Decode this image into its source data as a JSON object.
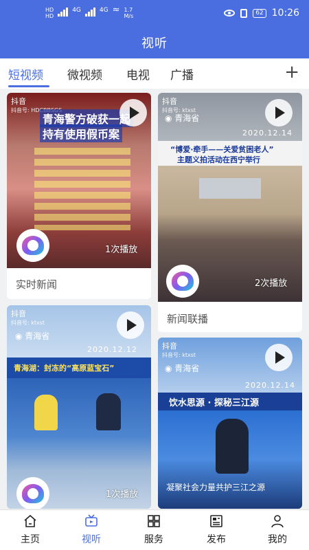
{
  "status": {
    "net1": "HD",
    "net2": "HD",
    "sig1": "4G",
    "sig2": "4G",
    "speed": "1.7",
    "speed_unit": "M/s",
    "battery": "62",
    "time": "10:26"
  },
  "header": {
    "title": "视听"
  },
  "tabs": [
    {
      "label": "短视频",
      "active": true
    },
    {
      "label": "微视频"
    },
    {
      "label": "电视"
    },
    {
      "label": "广播"
    }
  ],
  "cards": [
    {
      "platform": "抖音",
      "account": "抖音号: HDCBBSGS",
      "headline1": "青海警方破获一起",
      "headline2": "持有使用假币案",
      "plays": "1次播放",
      "caption": "实时新闻"
    },
    {
      "platform": "抖音",
      "account": "抖音号: ktxst",
      "location": "青海省",
      "date": "2020.12.14",
      "banner": "“博爱·牵手——关爱贫困老人”",
      "banner2": "主题义拍活动在西宁举行",
      "plays": "2次播放",
      "caption": "新闻联播"
    },
    {
      "platform": "抖音",
      "account": "抖音号: ktxst",
      "location": "青海省",
      "date": "2020.12.12",
      "banner": "青海湖：封冻的“高原蓝宝石”",
      "plays": "1次播放"
    },
    {
      "platform": "抖音",
      "account": "抖音号: ktxst",
      "location": "青海省",
      "date": "2020.12.14",
      "banner": "饮水思源 · 探秘三江源",
      "subtitle": "凝聚社会力量共护三江之源"
    }
  ],
  "nav": [
    {
      "label": "主页",
      "icon": "home-icon"
    },
    {
      "label": "视听",
      "icon": "tv-icon",
      "active": true
    },
    {
      "label": "服务",
      "icon": "grid-icon"
    },
    {
      "label": "发布",
      "icon": "newspaper-icon"
    },
    {
      "label": "我的",
      "icon": "user-icon"
    }
  ],
  "colors": {
    "accent": "#4a6de0"
  }
}
